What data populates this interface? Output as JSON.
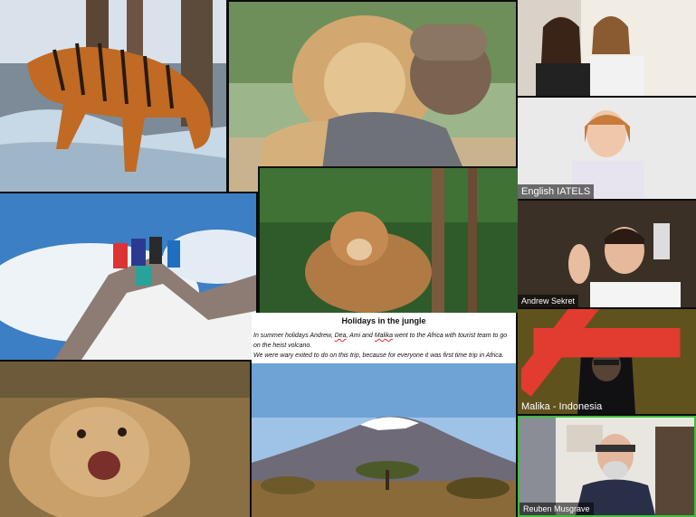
{
  "document": {
    "title": "Holidays in the jungle",
    "para_before_1": "In summer holidays Andrew, ",
    "name_dea": "Dea",
    "para_mid_1": ", Ami and ",
    "name_malika": "Malika",
    "para_after_1": " went to the Africa with tourist team to go on the heist volcano.",
    "para_2": "We were wary exited to do on this trip, because for everyone it was first time trip in Africa."
  },
  "participants": [
    {
      "name": ""
    },
    {
      "name": "English IATELS"
    },
    {
      "name": "Andrew Sekret"
    },
    {
      "name": "Malika - Indonesia",
      "muted": true
    },
    {
      "name": "Reuben Musgrave"
    }
  ],
  "colors": {
    "active_speaker_border": "#3cbf3c",
    "muted_icon": "#e23b2f"
  }
}
